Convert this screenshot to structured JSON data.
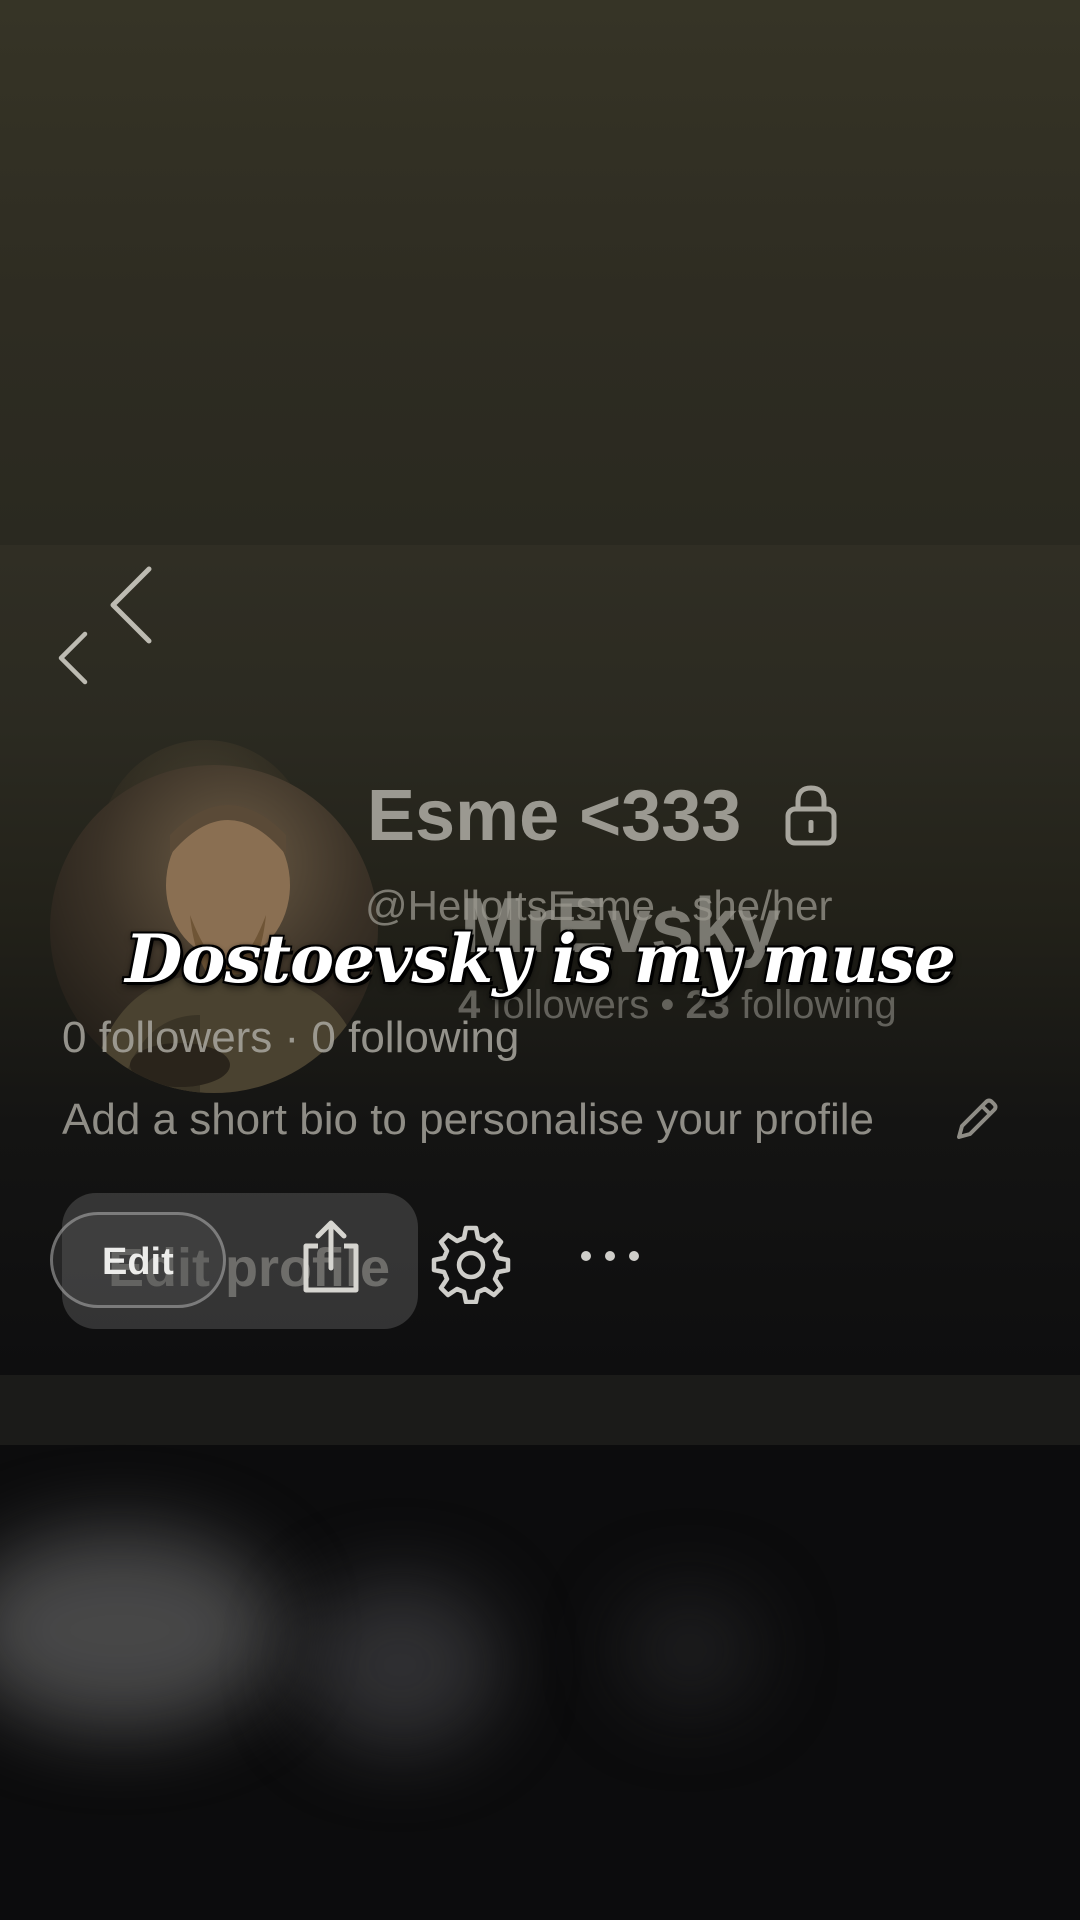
{
  "profile": {
    "display_name": "Esme <333",
    "handle_pronouns": "@HelloItsEsme · she/her",
    "followers_text": "0 followers · 0 following",
    "bio_placeholder": "Add a short bio to personalise your profile",
    "edit_profile_label": "Edit profile"
  },
  "ghost_profile": {
    "display_name": "MrEvsky",
    "followers_count": "4",
    "followers_label": "followers • ",
    "following_count": "23",
    "following_label": "following",
    "edit_label": "Edit"
  },
  "caption": "Dostoevsky is my muse",
  "icons": {
    "back": "chevron-left-icon",
    "lock": "lock-icon",
    "pencil": "pencil-icon",
    "share": "share-icon",
    "settings": "gear-icon",
    "more": "more-horizontal-icon"
  }
}
